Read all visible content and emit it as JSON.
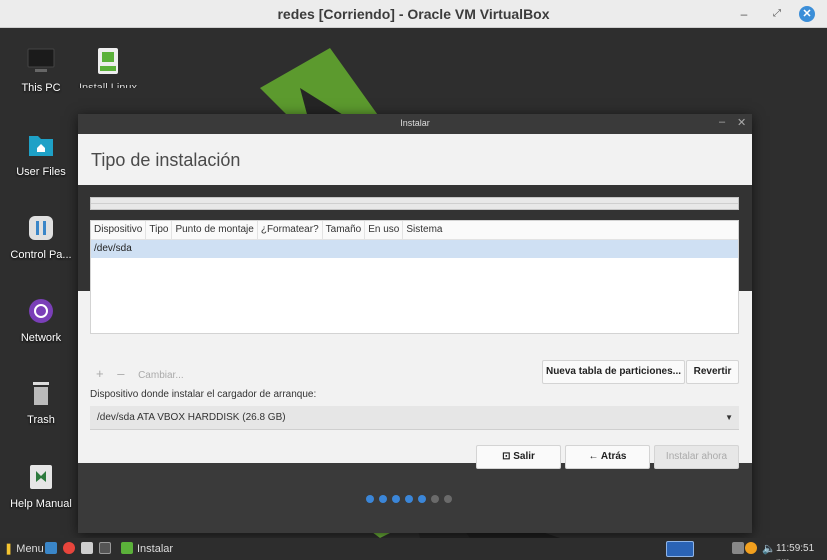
{
  "host": {
    "title": "redes [Corriendo] - Oracle VM VirtualBox",
    "minimize": "–",
    "maximize": "⤢",
    "close": "✕"
  },
  "desktop": {
    "icons": [
      {
        "label": "This PC",
        "icon": "computer-icon"
      },
      {
        "label": "User Files",
        "icon": "folder-home-icon"
      },
      {
        "label": "Control Pa...",
        "icon": "control-panel-icon"
      },
      {
        "label": "Network",
        "icon": "network-icon"
      },
      {
        "label": "Trash",
        "icon": "trash-icon"
      },
      {
        "label": "Help Manual",
        "icon": "help-manual-icon"
      },
      {
        "label": "Install Linux",
        "icon": "install-icon"
      }
    ]
  },
  "installer": {
    "window_title": "Instalar",
    "minimize": "–",
    "close": "✕",
    "heading": "Tipo de instalación",
    "table": {
      "columns": [
        "Dispositivo",
        "Tipo",
        "Punto de montaje",
        "¿Formatear?",
        "Tamaño",
        "En uso",
        "Sistema"
      ],
      "rows": [
        [
          "/dev/sda"
        ]
      ]
    },
    "add_label": "+",
    "remove_label": "–",
    "change_label": "Cambiar...",
    "new_table_label": "Nueva tabla de particiones...",
    "revert_label": "Revertir",
    "bootloader_label": "Dispositivo donde instalar el cargador de arranque:",
    "bootloader_value": "/dev/sda ATA VBOX HARDDISK (26.8 GB)",
    "quit_label": "Salir",
    "back_label": "← Atrás",
    "install_label": "Instalar ahora",
    "progress_steps_total": 7,
    "progress_steps_done": 5,
    "colors": {
      "active_dot": "#3b86d8",
      "inactive_dot": "#6a6a6a"
    }
  },
  "taskbar": {
    "menu_label": "Menu",
    "task_label": "Instalar",
    "clock": "11:59:51 pm"
  }
}
